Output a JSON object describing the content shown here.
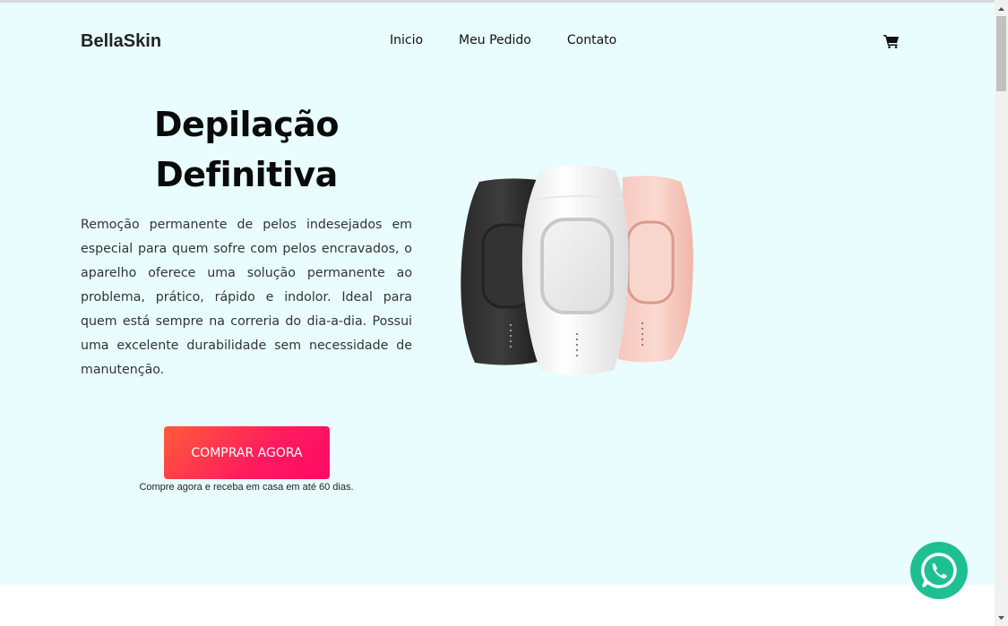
{
  "header": {
    "logo": "BellaSkin",
    "nav": [
      "Inicio",
      "Meu Pedido",
      "Contato"
    ],
    "cart_icon": "shopping-cart-icon"
  },
  "hero": {
    "title_line1": "Depilação",
    "title_line2": "Definitiva",
    "description": "Remoção permanente de pelos indesejados em especial para quem sofre com pelos encravados, o aparelho oferece uma solução permanente ao problema, prático, rápido e indolor. Ideal para quem está sempre na correria do dia-a-dia. Possui uma excelente durabilidade sem necessidade de manutenção.",
    "cta_label": "COMPRAR AGORA",
    "cta_note": "Compre agora e receba em casa em até 60 dias.",
    "product_image": "ipl-hair-removal-devices"
  },
  "floating": {
    "whatsapp_icon": "whatsapp-icon"
  },
  "colors": {
    "hero_background": "#e9fdff",
    "cta_gradient_start": "#ff5c3a",
    "cta_gradient_end": "#ff0a66",
    "whatsapp_green": "#1fbf94"
  }
}
